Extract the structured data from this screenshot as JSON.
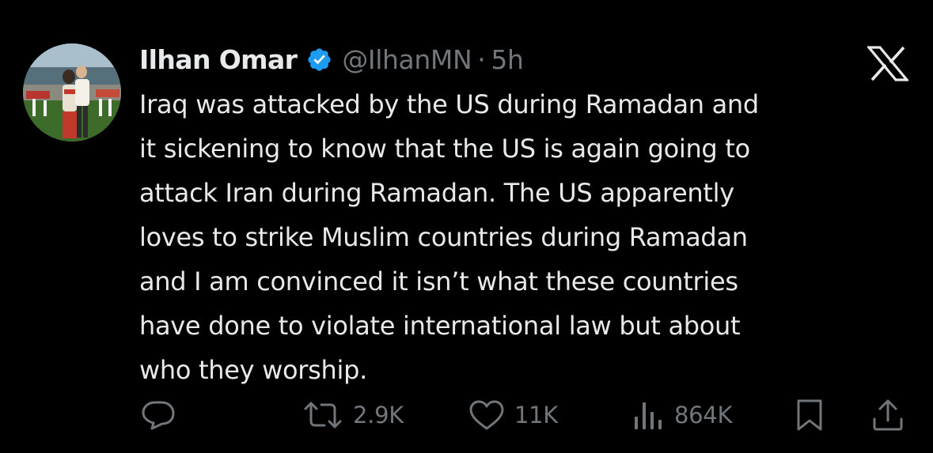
{
  "author": {
    "display_name": "Ilhan Omar",
    "handle": "@IlhanMN",
    "separator": "·",
    "timestamp": "5h",
    "verified_color": "#1d9bf0"
  },
  "tweet": {
    "text": "Iraq was attacked by the US during Ramadan and\nit sickening to know that the US is again going to\nattack Iran during Ramadan.  The US apparently\nloves to strike Muslim countries during Ramadan\nand I am convinced it isn’t what these countries\nhave done to violate international law but about\nwho they worship."
  },
  "actions": {
    "reply_icon": "reply-icon",
    "retweet_icon": "retweet-icon",
    "retweet_count": "2.9K",
    "like_icon": "heart-icon",
    "like_count": "11K",
    "views_icon": "views-chart-icon",
    "views_count": "864K",
    "bookmark_icon": "bookmark-icon",
    "share_icon": "share-icon"
  },
  "colors": {
    "background": "#000000",
    "text_primary": "#e7e9ea",
    "text_secondary": "#71767b"
  }
}
